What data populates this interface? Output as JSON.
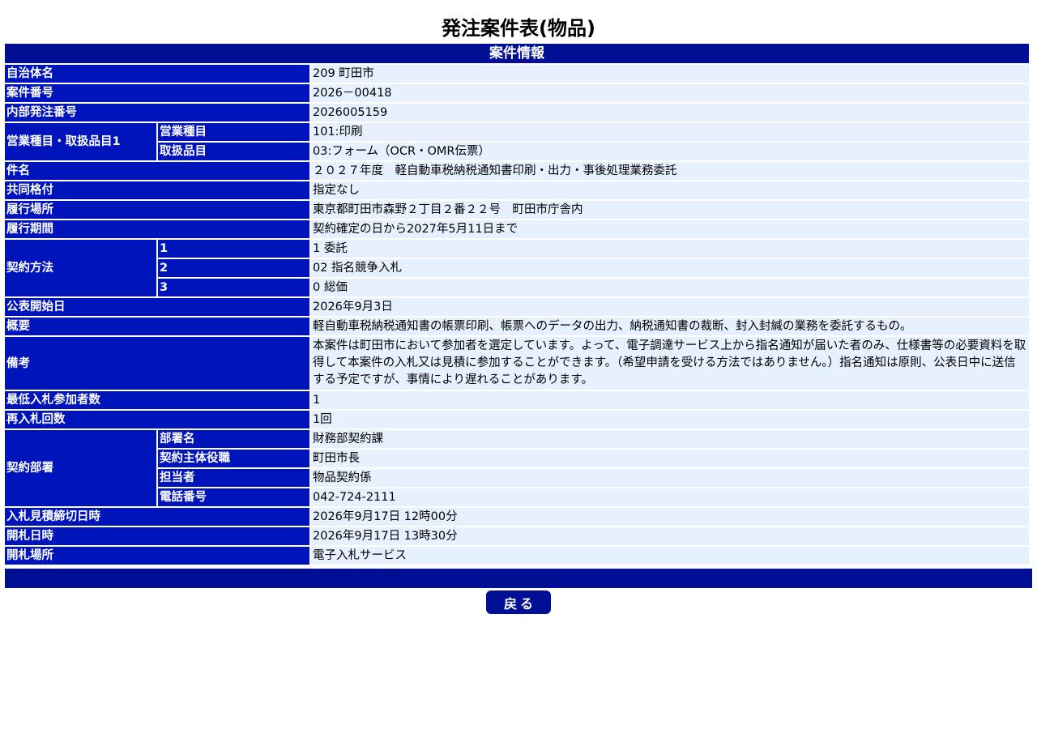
{
  "page": {
    "title": "発注案件表(物品)",
    "section_header": "案件情報",
    "back_button_label": "戻る"
  },
  "colors": {
    "header_navy": "#000f94",
    "label_blue": "#0014bb",
    "value_bg": "#e6f0ff"
  },
  "fields": {
    "municipality": {
      "label": "自治体名",
      "value": "209 町田市"
    },
    "case_number": {
      "label": "案件番号",
      "value": "2026－00418"
    },
    "internal_order_number": {
      "label": "内部発注番号",
      "value": "2026005159"
    },
    "business_category": {
      "label": "営業種目・取扱品目1",
      "business_item": {
        "label": "営業種目",
        "value": "101:印刷"
      },
      "handling_item": {
        "label": "取扱品目",
        "value": "03:フォーム（OCR・OMR伝票）"
      }
    },
    "subject": {
      "label": "件名",
      "value": "２０２７年度　軽自動車税納税通知書印刷・出力・事後処理業務委託"
    },
    "joint_rating": {
      "label": "共同格付",
      "value": "指定なし"
    },
    "performance_location": {
      "label": "履行場所",
      "value": "東京都町田市森野２丁目２番２２号　町田市庁舎内"
    },
    "performance_period": {
      "label": "履行期間",
      "value": "契約確定の日から2027年5月11日まで"
    },
    "contract_method": {
      "label": "契約方法",
      "items": [
        {
          "label": "1",
          "value": "1 委託"
        },
        {
          "label": "2",
          "value": "02 指名競争入札"
        },
        {
          "label": "3",
          "value": "0 総価"
        }
      ]
    },
    "publication_start": {
      "label": "公表開始日",
      "value": "2026年9月3日"
    },
    "overview": {
      "label": "概要",
      "value": "軽自動車税納税通知書の帳票印刷、帳票へのデータの出力、納税通知書の裁断、封入封緘の業務を委託するもの。"
    },
    "remarks": {
      "label": "備考",
      "value": "本案件は町田市において参加者を選定しています。よって、電子調達サービス上から指名通知が届いた者のみ、仕様書等の必要資料を取得して本案件の入札又は見積に参加することができます。（希望申請を受ける方法ではありません。）指名通知は原則、公表日中に送信する予定ですが、事情により遅れることがあります。"
    },
    "min_participants": {
      "label": "最低入札参加者数",
      "value": "1"
    },
    "rebid_count": {
      "label": "再入札回数",
      "value": "1回"
    },
    "contract_department": {
      "label": "契約部署",
      "department_name": {
        "label": "部署名",
        "value": "財務部契約課"
      },
      "contract_authority": {
        "label": "契約主体役職",
        "value": "町田市長"
      },
      "person_in_charge": {
        "label": "担当者",
        "value": "物品契約係"
      },
      "phone": {
        "label": "電話番号",
        "value": "042-724-2111"
      }
    },
    "bid_deadline": {
      "label": "入札見積締切日時",
      "value": "2026年9月17日 12時00分"
    },
    "opening_datetime": {
      "label": "開札日時",
      "value": "2026年9月17日 13時30分"
    },
    "opening_location": {
      "label": "開札場所",
      "value": "電子入札サービス"
    }
  }
}
